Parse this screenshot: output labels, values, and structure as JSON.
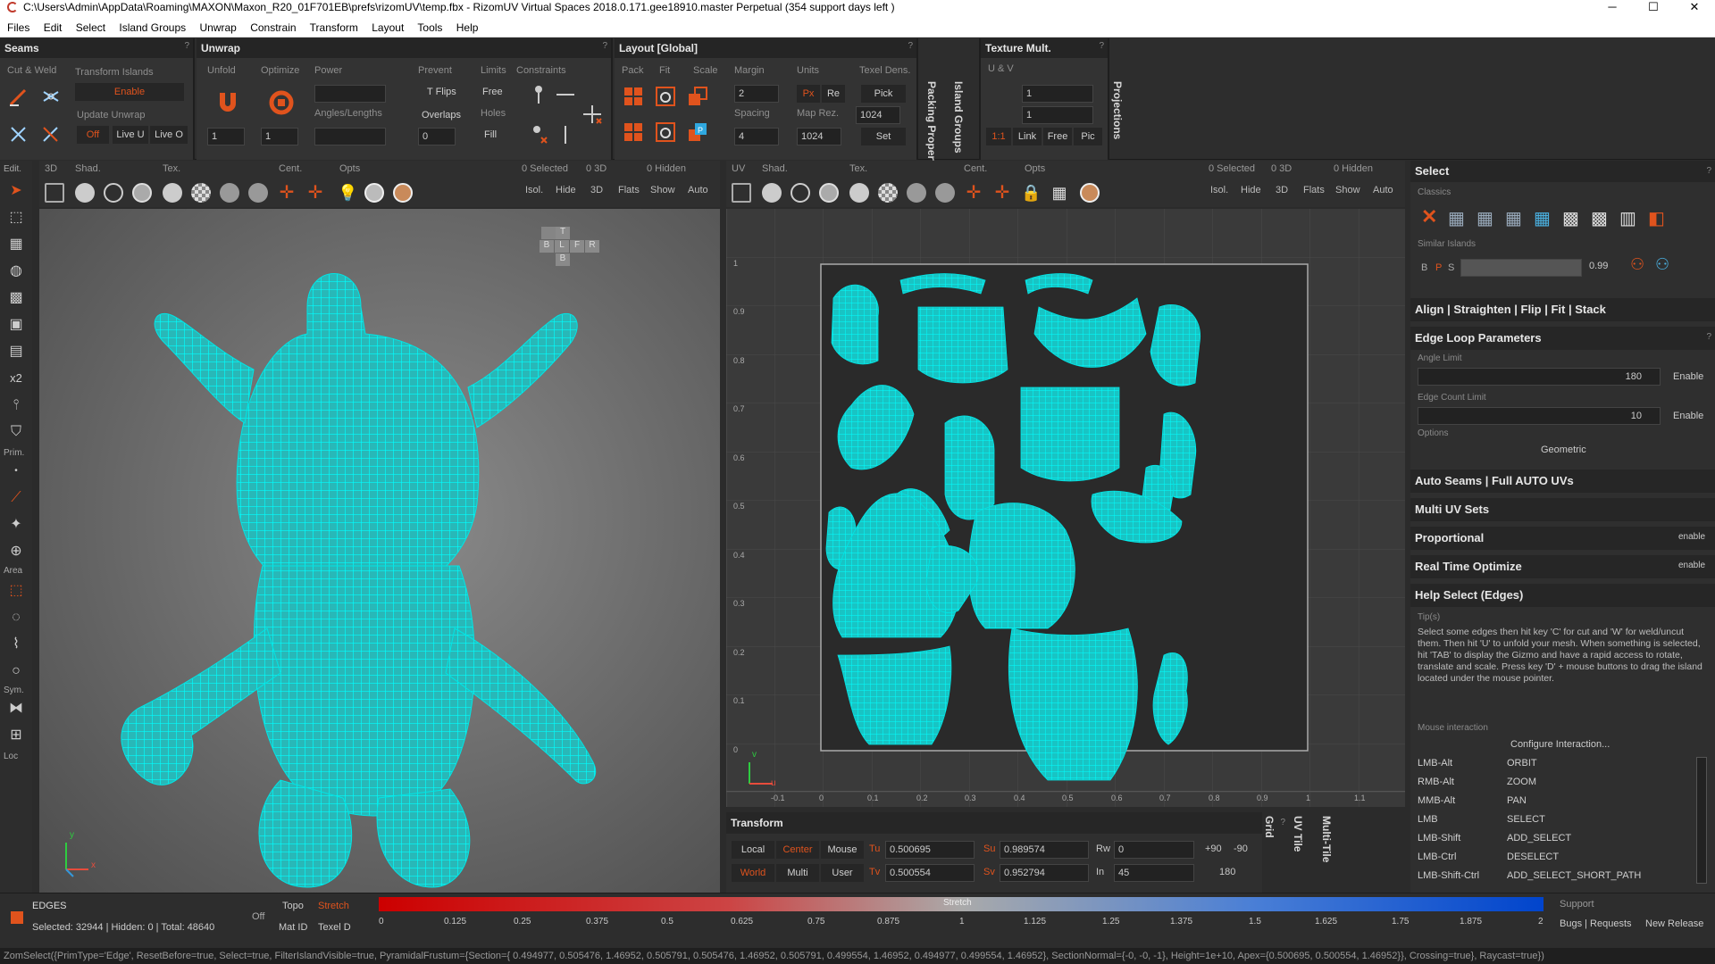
{
  "window": {
    "title": "C:\\Users\\Admin\\AppData\\Roaming\\MAXON\\Maxon_R20_01F701EB\\prefs\\rizomUV\\temp.fbx - RizomUV  Virtual Spaces 2018.0.171.gee18910.master Perpetual  (354 support days left )",
    "min": "─",
    "max": "☐",
    "close": "✕"
  },
  "menu": [
    "Files",
    "Edit",
    "Select",
    "Island Groups",
    "Unwrap",
    "Constrain",
    "Transform",
    "Layout",
    "Tools",
    "Help"
  ],
  "seams": {
    "title": "Seams",
    "cut_weld": "Cut & Weld",
    "transform_islands": "Transform Islands",
    "enable": "Enable",
    "update_unwrap": "Update Unwrap",
    "off": "Off",
    "live_u": "Live U",
    "live_o": "Live O"
  },
  "unwrap": {
    "title": "Unwrap",
    "unfold": "Unfold",
    "optimize": "Optimize",
    "power": "Power",
    "prevent": "Prevent",
    "limits": "Limits",
    "constraints": "Constraints",
    "t_flips": "T Flips",
    "free": "Free",
    "angles_lengths": "Angles/Lengths",
    "overlaps": "Overlaps",
    "holes": "Holes",
    "fill": "Fill",
    "val1": "1",
    "val2": "1",
    "val0": "0"
  },
  "layout": {
    "title": "Layout [Global]",
    "pack": "Pack",
    "fit": "Fit",
    "scale": "Scale",
    "margin": "Margin",
    "margin_val": "2",
    "units": "Units",
    "px": "Px",
    "re": "Re",
    "texel_dens": "Texel Dens.",
    "pick": "Pick",
    "spacing": "Spacing",
    "spacing_val": "4",
    "map_rez": "Map Rez.",
    "map_rez_val1": "1024",
    "map_rez_val2": "1024",
    "set": "Set"
  },
  "vtabs": {
    "packing": "Packing Properties [I",
    "island_groups": "Island Groups",
    "projections": "Projections"
  },
  "texture_mult": {
    "title": "Texture Mult.",
    "uv": "U & V",
    "val1": "1",
    "val2": "1",
    "one_one": "1:1",
    "link": "Link",
    "free": "Free",
    "pic": "Pic"
  },
  "view3d_toolbar": {
    "edit": "Edit.",
    "d3": "3D",
    "shad": "Shad.",
    "tex": "Tex.",
    "cent": "Cent.",
    "opts": "Opts",
    "selected": "0 Selected",
    "zero3d": "0 3D",
    "hidden": "0 Hidden",
    "isol": "Isol.",
    "hide": "Hide",
    "b3d": "3D",
    "flats": "Flats",
    "show": "Show",
    "auto": "Auto"
  },
  "viewuv_toolbar": {
    "uv": "UV",
    "shad": "Shad.",
    "tex": "Tex.",
    "cent": "Cent.",
    "opts": "Opts",
    "selected": "0 Selected",
    "zero3d": "0 3D",
    "hidden": "0 Hidden",
    "isol": "Isol.",
    "hide": "Hide",
    "b3d": "3D",
    "flats": "Flats",
    "show": "Show",
    "auto": "Auto"
  },
  "left_tools": {
    "x2": "x2",
    "prim": "Prim.",
    "area": "Area",
    "sym": "Sym.",
    "loc": "Loc"
  },
  "view3d": {
    "axis_y": "y",
    "axis_x": "x",
    "cube": [
      "T",
      "B",
      "L",
      "F",
      "R",
      "B"
    ]
  },
  "uv_axis": {
    "y_ticks": [
      "1",
      "0.9",
      "0.8",
      "0.7",
      "0.6",
      "0.5",
      "0.4",
      "0.3",
      "0.2",
      "0.1",
      "0"
    ],
    "x_ticks": [
      "-0.1",
      "0",
      "0.1",
      "0.2",
      "0.3",
      "0.4",
      "0.5",
      "0.6",
      "0.7",
      "0.8",
      "0.9",
      "1",
      "1.1"
    ],
    "v": "v",
    "u": "u"
  },
  "right": {
    "select": "Select",
    "classics": "Classics",
    "similar_islands": "Similar Islands",
    "b": "B",
    "p": "P",
    "s": "S",
    "similar_val": "0.99",
    "align": "Align | Straighten | Flip | Fit | Stack",
    "edge_loop": "Edge Loop Parameters",
    "angle_limit": "Angle Limit",
    "angle_val": "180",
    "enable": "Enable",
    "edge_count": "Edge Count Limit",
    "edge_count_val": "10",
    "options": "Options",
    "geometric": "Geometric",
    "auto_seams": "Auto Seams | Full AUTO UVs",
    "multi_uv": "Multi UV Sets",
    "proportional": "Proportional",
    "real_time": "Real Time Optimize",
    "enable_small": "enable",
    "help_select": "Help Select (Edges)",
    "tips": "Tip(s)",
    "help_text": "Select some edges then hit key 'C' for cut and 'W' for weld/uncut them. Then hit 'U' to unfold your mesh. When something is selected, hit 'TAB' to display the Gizmo and have a rapid access to rotate, translate and scale. Press key 'D' + mouse buttons to drag the island located under the mouse pointer.",
    "mouse_interaction": "Mouse interaction",
    "configure": "Configure Interaction...",
    "mouse": [
      [
        "LMB-Alt",
        "ORBIT"
      ],
      [
        "RMB-Alt",
        "ZOOM"
      ],
      [
        "MMB-Alt",
        "PAN"
      ],
      [
        "LMB",
        "SELECT"
      ],
      [
        "LMB-Shift",
        "ADD_SELECT"
      ],
      [
        "LMB-Ctrl",
        "DESELECT"
      ],
      [
        "LMB-Shift-Ctrl",
        "ADD_SELECT_SHORT_PATH"
      ]
    ]
  },
  "transform": {
    "title": "Transform",
    "local": "Local",
    "center": "Center",
    "mouse": "Mouse",
    "world": "World",
    "multi": "Multi",
    "user": "User",
    "tu": "Tu",
    "tu_val": "0.500695",
    "tv": "Tv",
    "tv_val": "0.500554",
    "su": "Su",
    "su_val": "0.989574",
    "sv": "Sv",
    "sv_val": "0.952794",
    "rw": "Rw",
    "rw_val": "0",
    "in": "In",
    "in_val": "45",
    "p90": "+90",
    "m90": "-90",
    "r180": "180"
  },
  "bottom_vtabs": {
    "grid": "Grid",
    "uv_tile": "UV Tile",
    "multi_tile": "Multi-Tile"
  },
  "status": {
    "edges": "EDGES",
    "selected": "Selected: 32944 | Hidden: 0 | Total: 48640",
    "off": "Off",
    "topo": "Topo",
    "stretch": "Stretch",
    "mat_id": "Mat ID",
    "texel_d": "Texel D",
    "stretch_label": "Stretch",
    "scale": [
      "0",
      "0.125",
      "0.25",
      "0.375",
      "0.5",
      "0.625",
      "0.75",
      "0.875",
      "1",
      "1.125",
      "1.25",
      "1.375",
      "1.5",
      "1.625",
      "1.75",
      "1.875",
      "2"
    ],
    "support": "Support",
    "bugs": "Bugs | Requests",
    "new_release": "New Release"
  },
  "cmdline": "ZomSelect({PrimType='Edge', ResetBefore=true, Select=true, FilterIslandVisible=true, PyramidalFrustum={Section={ 0.494977, 0.505476, 1.46952, 0.505791, 0.505476, 1.46952, 0.505791, 0.499554, 1.46952, 0.494977, 0.499554, 1.46952}, SectionNormal={-0, -0, -1}, Height=1e+10, Apex={0.500695, 0.500554, 1.46952}}, Crossing=true}, Raycast=true})",
  "colors": {
    "accent": "#e0531d",
    "mesh": "#00e5e5",
    "bg": "#2d2d2d"
  }
}
